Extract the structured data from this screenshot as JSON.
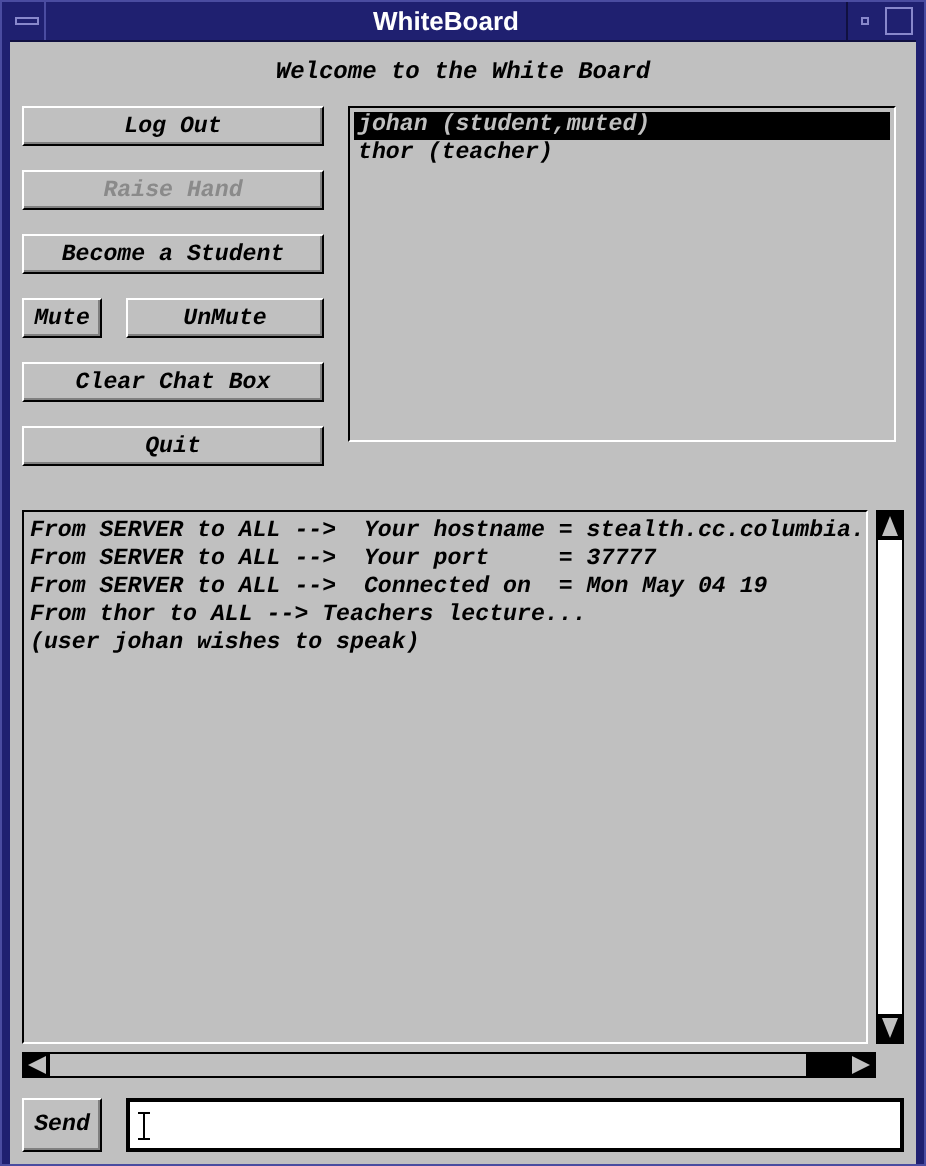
{
  "window": {
    "title": "WhiteBoard"
  },
  "welcome": "Welcome to the White Board",
  "button_rows": [
    [
      {
        "label": "Log Out",
        "disabled": false
      }
    ],
    [
      {
        "label": "Raise Hand",
        "disabled": true
      }
    ],
    [
      {
        "label": "Become a Student",
        "disabled": false
      }
    ],
    [
      {
        "label": "Mute",
        "disabled": false
      },
      {
        "label": "UnMute",
        "disabled": false
      }
    ],
    [
      {
        "label": "Clear Chat Box",
        "disabled": false
      }
    ],
    [
      {
        "label": "Quit",
        "disabled": false
      }
    ]
  ],
  "users": [
    {
      "label": "johan (student,muted)",
      "selected": true
    },
    {
      "label": "thor (teacher)",
      "selected": false
    }
  ],
  "chat_lines": [
    "From SERVER to ALL -->  Your hostname = stealth.cc.columbia.",
    "From SERVER to ALL -->  Your port     = 37777",
    "From SERVER to ALL -->  Connected on  = Mon May 04 19",
    "From thor to ALL --> Teachers lecture...",
    "(user johan wishes to speak)"
  ],
  "send_button": "Send"
}
